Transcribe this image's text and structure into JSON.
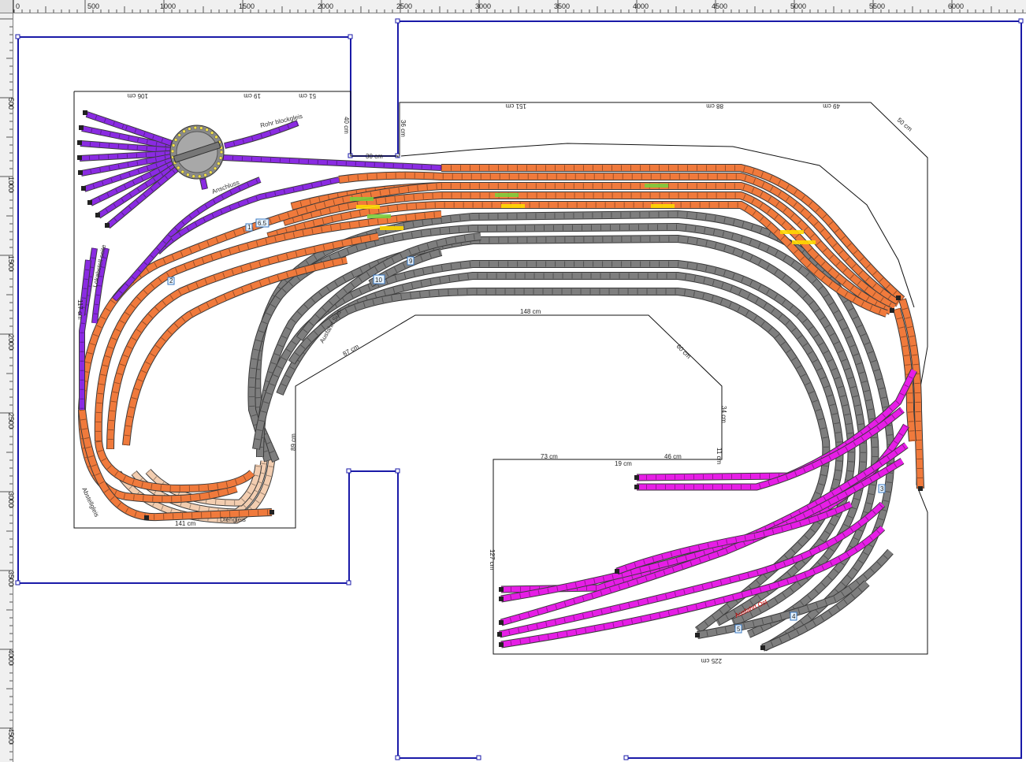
{
  "ruler": {
    "top_labels": [
      "0",
      "500",
      "1000",
      "1500",
      "2000",
      "2500",
      "3000",
      "3500",
      "4000",
      "4500",
      "5000",
      "5500",
      "6000"
    ],
    "left_labels": [
      "500",
      "1000",
      "1500",
      "2000",
      "2500",
      "3000",
      "3500",
      "4000",
      "4500"
    ]
  },
  "dimensions": {
    "d106": "106 cm",
    "d19a": "19 cm",
    "d51": "51 cm",
    "d40": "40 cm",
    "d36": "36 cm",
    "d30": "30 cm",
    "d151": "151 cm",
    "d88": "88 cm",
    "d49": "49 cm",
    "d50": "50 cm",
    "d148": "148 cm",
    "d87": "87 cm",
    "d60": "60 cm",
    "d34": "34 cm",
    "d11": "11 cm",
    "d73": "73 cm",
    "d19b": "19 cm",
    "d46": "46 cm",
    "d89": "89 cm",
    "d141": "141 cm",
    "d127": "127 cm",
    "d225": "225 cm",
    "d117": "117 cm"
  },
  "labels": {
    "rohr": "Rohr blockgleis",
    "anschluss": "Anschluss",
    "lokabstell": "Lokabstell seite",
    "ausfahrt_sud": "Ausfahrt Süd",
    "ausfahrt_ost": "Ausfahrt Ost",
    "diehgleis": "Diehgleis",
    "abstellgleis": "Abstellgleis"
  },
  "signals": [
    "1",
    "6.5",
    "2",
    "9",
    "10",
    "3",
    "4",
    "5"
  ],
  "colors": {
    "orange": "#f07a3c",
    "gray": "#7e7e7e",
    "purple": "#8a2be2",
    "magenta": "#e61ee6",
    "tan": "#f2cdb0",
    "wall": "#1a1aa8",
    "turntable": "#9a9a9a",
    "lamp": "#f2e04a",
    "yellow_marker": "#ffd800",
    "green_marker": "#7ccd3c",
    "dim_red": "#d40000"
  }
}
